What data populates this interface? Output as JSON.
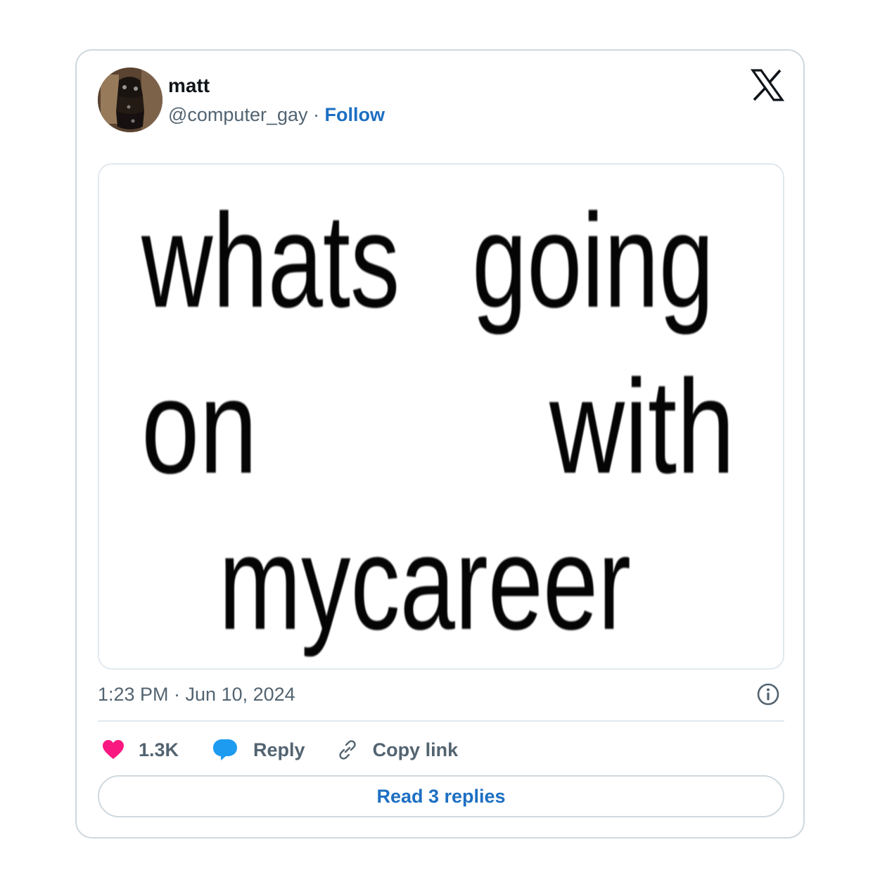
{
  "tweet": {
    "author": {
      "display_name": "matt",
      "handle": "@computer_gay",
      "separator": "·",
      "follow_label": "Follow",
      "avatar_icon": "profile-photo"
    },
    "brand_icon": "x-logo-icon",
    "media": {
      "words": [
        "whats",
        "going",
        "on",
        "with",
        "mycareer"
      ]
    },
    "timestamp": "1:23 PM · Jun 10, 2024",
    "info_icon": "info-circle-icon",
    "actions": {
      "like_count": "1.3K",
      "reply_label": "Reply",
      "copy_label": "Copy link"
    },
    "read_replies_label": "Read 3 replies"
  },
  "colors": {
    "like_heart": "#f91880",
    "reply_bubble": "#1d9bf0",
    "link_blue": "#1d6fc2",
    "muted_text": "#536471",
    "border": "#cfd9de"
  }
}
